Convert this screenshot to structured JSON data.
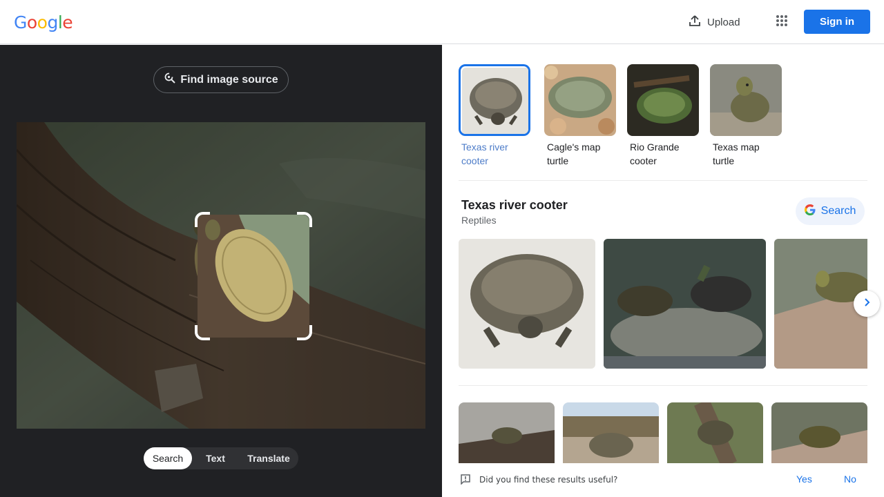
{
  "header": {
    "logo_letters": [
      {
        "ch": "G",
        "color": "#4285F4"
      },
      {
        "ch": "o",
        "color": "#EA4335"
      },
      {
        "ch": "o",
        "color": "#FBBC05"
      },
      {
        "ch": "g",
        "color": "#4285F4"
      },
      {
        "ch": "l",
        "color": "#34A853"
      },
      {
        "ch": "e",
        "color": "#EA4335"
      }
    ],
    "upload_label": "Upload",
    "upload_icon": "upload-icon",
    "apps_icon": "apps-grid-icon",
    "signin_label": "Sign in"
  },
  "left_panel": {
    "find_source_label": "Find image source",
    "find_source_icon": "lens-search-icon",
    "modes": [
      "Search",
      "Text",
      "Translate"
    ],
    "active_mode": "Search"
  },
  "results": {
    "chips": [
      {
        "label": "Texas river cooter",
        "selected": true
      },
      {
        "label": "Cagle's map turtle",
        "selected": false
      },
      {
        "label": "Rio Grande cooter",
        "selected": false
      },
      {
        "label": "Texas map turtle",
        "selected": false
      }
    ],
    "knowledge": {
      "title": "Texas river cooter",
      "subtitle": "Reptiles",
      "search_label": "Search"
    },
    "feedback": {
      "question": "Did you find these results useful?",
      "yes": "Yes",
      "no": "No"
    }
  },
  "colors": {
    "accent": "#1a73e8",
    "dark_panel": "#202124",
    "chip_selected_text": "#4d7cc8"
  }
}
